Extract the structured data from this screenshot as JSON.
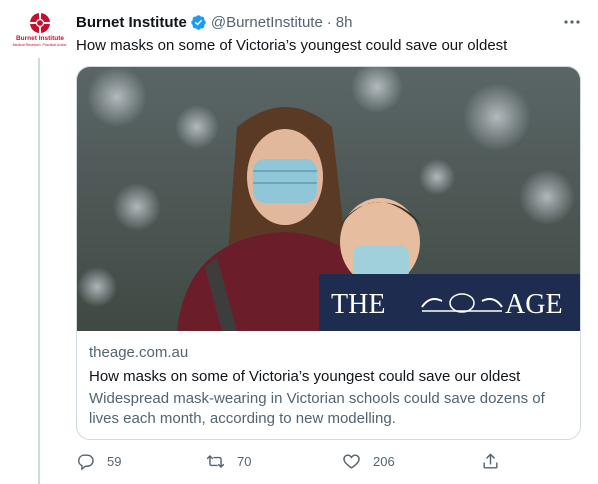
{
  "tweet": {
    "author_name": "Burnet Institute",
    "handle": "@BurnetInstitute",
    "separator": "·",
    "time": "8h",
    "text": "How masks on some of Victoria’s youngest could save our oldest",
    "avatar": {
      "logo_text": "Burnet Institute",
      "logo_sub": "Medical Research. Practical Action."
    }
  },
  "card": {
    "domain": "theage.com.au",
    "title": "How masks on some of Victoria’s youngest could save our oldest",
    "description": "Widespread mask-wearing in Victorian schools could save dozens of lives each month, according to new modelling.",
    "image_banner_left": "THE",
    "image_banner_right": "AGE"
  },
  "actions": {
    "replies": "59",
    "retweets": "70",
    "likes": "206"
  },
  "colors": {
    "text_primary": "#0f1419",
    "text_secondary": "#536471",
    "verified": "#1d9bf0",
    "border": "#cfd9de",
    "brand_red": "#c8102e",
    "banner_navy": "#1e2d4f"
  },
  "icons": [
    "verified-badge-icon",
    "more-options-icon",
    "reply-icon",
    "retweet-icon",
    "like-icon",
    "share-icon"
  ]
}
